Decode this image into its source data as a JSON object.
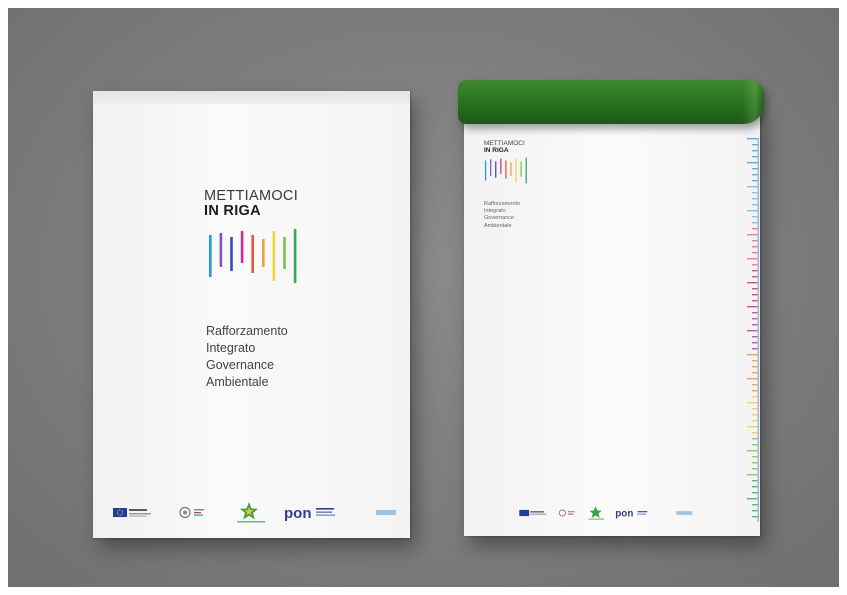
{
  "brand": {
    "line1": "METTIAMOCI",
    "line2": "IN RIGA",
    "bar_colors": [
      "#1d9bd7",
      "#7a55c6",
      "#3a4bb8",
      "#c9308f",
      "#e8553c",
      "#e8a33a",
      "#f1d53a",
      "#7cc44a",
      "#2fa85c"
    ]
  },
  "folder": {
    "subtitle": [
      "Rafforzamento",
      "Integrato",
      "Governance",
      "Ambientale"
    ],
    "footer_logos": [
      "eu-flag-icon",
      "italian-emblem-icon",
      "green-star-icon",
      "pon-logo"
    ]
  },
  "notepad": {
    "binding_color": "#2e7a24",
    "subtitle": [
      "Rafforzamento",
      "Integrato",
      "Governance",
      "Ambientale"
    ],
    "footer_logos": [
      "eu-flag-icon",
      "italian-emblem-icon",
      "green-star-icon",
      "pon-logo"
    ]
  },
  "footer": {
    "pon_text": "pon"
  }
}
